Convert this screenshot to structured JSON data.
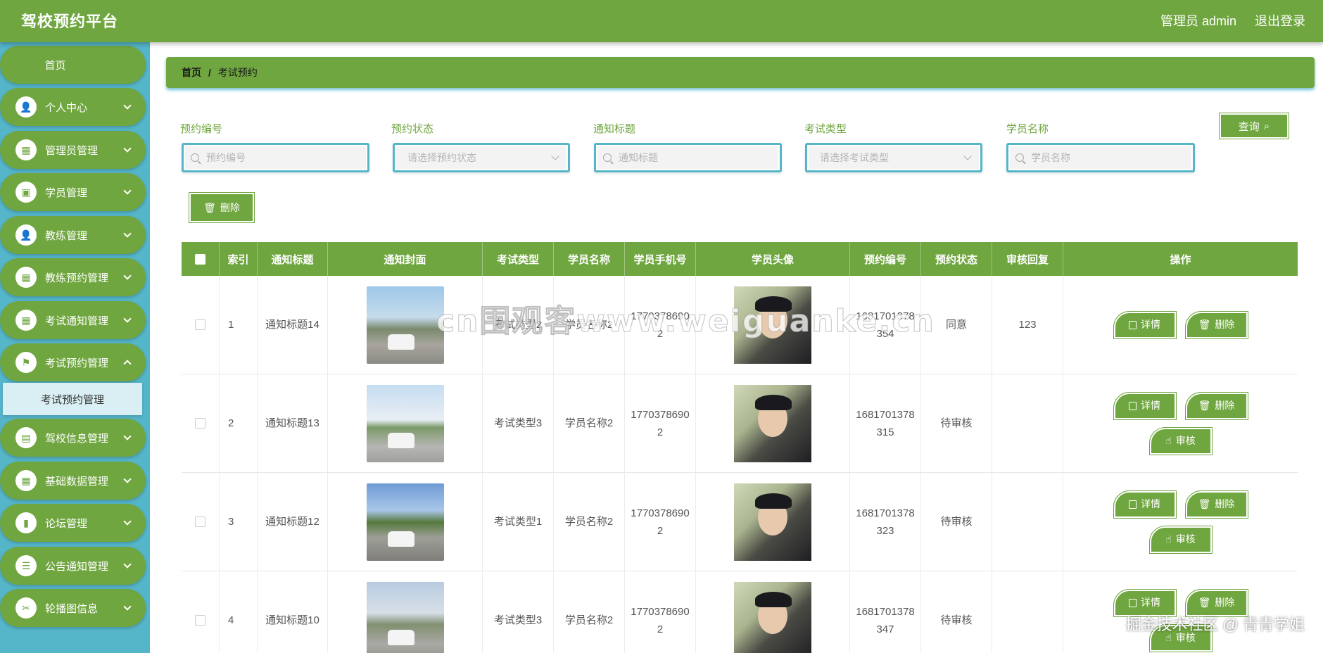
{
  "header": {
    "brand": "驾校预约平台",
    "user": "管理员 admin",
    "logout": "退出登录",
    "color": "#6fa63f"
  },
  "sidebar": {
    "color": "#55b5c9",
    "items": [
      {
        "label": "首页",
        "icon": "home"
      },
      {
        "label": "个人中心",
        "icon": "user-icon"
      },
      {
        "label": "管理员管理",
        "icon": "grid-icon"
      },
      {
        "label": "学员管理",
        "icon": "briefcase-icon"
      },
      {
        "label": "教练管理",
        "icon": "user-icon"
      },
      {
        "label": "教练预约管理",
        "icon": "grid-icon"
      },
      {
        "label": "考试通知管理",
        "icon": "grid-icon"
      },
      {
        "label": "考试预约管理",
        "icon": "flag-icon"
      },
      {
        "label": "驾校信息管理",
        "icon": "wallet-icon"
      },
      {
        "label": "基础数据管理",
        "icon": "grid-icon"
      },
      {
        "label": "论坛管理",
        "icon": "bar-chart-icon"
      },
      {
        "label": "公告通知管理",
        "icon": "list-icon"
      },
      {
        "label": "轮播图信息",
        "icon": "ticket-icon"
      }
    ],
    "active_sub": "考试预约管理"
  },
  "breadcrumb": {
    "home": "首页",
    "separator": "/",
    "current": "考试预约"
  },
  "search": {
    "fields": [
      {
        "label": "预约编号",
        "placeholder": "预约编号",
        "type": "input"
      },
      {
        "label": "预约状态",
        "placeholder": "请选择预约状态",
        "type": "select"
      },
      {
        "label": "通知标题",
        "placeholder": "通知标题",
        "type": "input"
      },
      {
        "label": "考试类型",
        "placeholder": "请选择考试类型",
        "type": "select"
      },
      {
        "label": "学员名称",
        "placeholder": "学员名称",
        "type": "input"
      }
    ],
    "query_button": "查询",
    "delete_button": "删除"
  },
  "table": {
    "columns": [
      "索引",
      "通知标题",
      "通知封面",
      "考试类型",
      "学员名称",
      "学员手机号",
      "学员头像",
      "预约编号",
      "预约状态",
      "审核回复",
      "操作"
    ],
    "rows": [
      {
        "index": "1",
        "title": "通知标题14",
        "exam_type": "考试类型2",
        "student": "学员名称2",
        "phone": "17703786902",
        "booking_no": "1681701378354",
        "status": "同意",
        "reply": "123",
        "actions": [
          "详情",
          "删除"
        ]
      },
      {
        "index": "2",
        "title": "通知标题13",
        "exam_type": "考试类型3",
        "student": "学员名称2",
        "phone": "17703786902",
        "booking_no": "1681701378315",
        "status": "待审核",
        "reply": "",
        "actions": [
          "详情",
          "删除",
          "审核"
        ]
      },
      {
        "index": "3",
        "title": "通知标题12",
        "exam_type": "考试类型1",
        "student": "学员名称2",
        "phone": "17703786902",
        "booking_no": "1681701378323",
        "status": "待审核",
        "reply": "",
        "actions": [
          "详情",
          "删除",
          "审核"
        ]
      },
      {
        "index": "4",
        "title": "通知标题10",
        "exam_type": "考试类型3",
        "student": "学员名称2",
        "phone": "17703786902",
        "booking_no": "1681701378347",
        "status": "待审核",
        "reply": "",
        "actions": [
          "详情",
          "删除",
          "审核"
        ]
      }
    ]
  },
  "watermarks": {
    "center": "cn围观客www.weiguanke.cn",
    "corner": "掘金技术社区 @ 青青学姐"
  }
}
